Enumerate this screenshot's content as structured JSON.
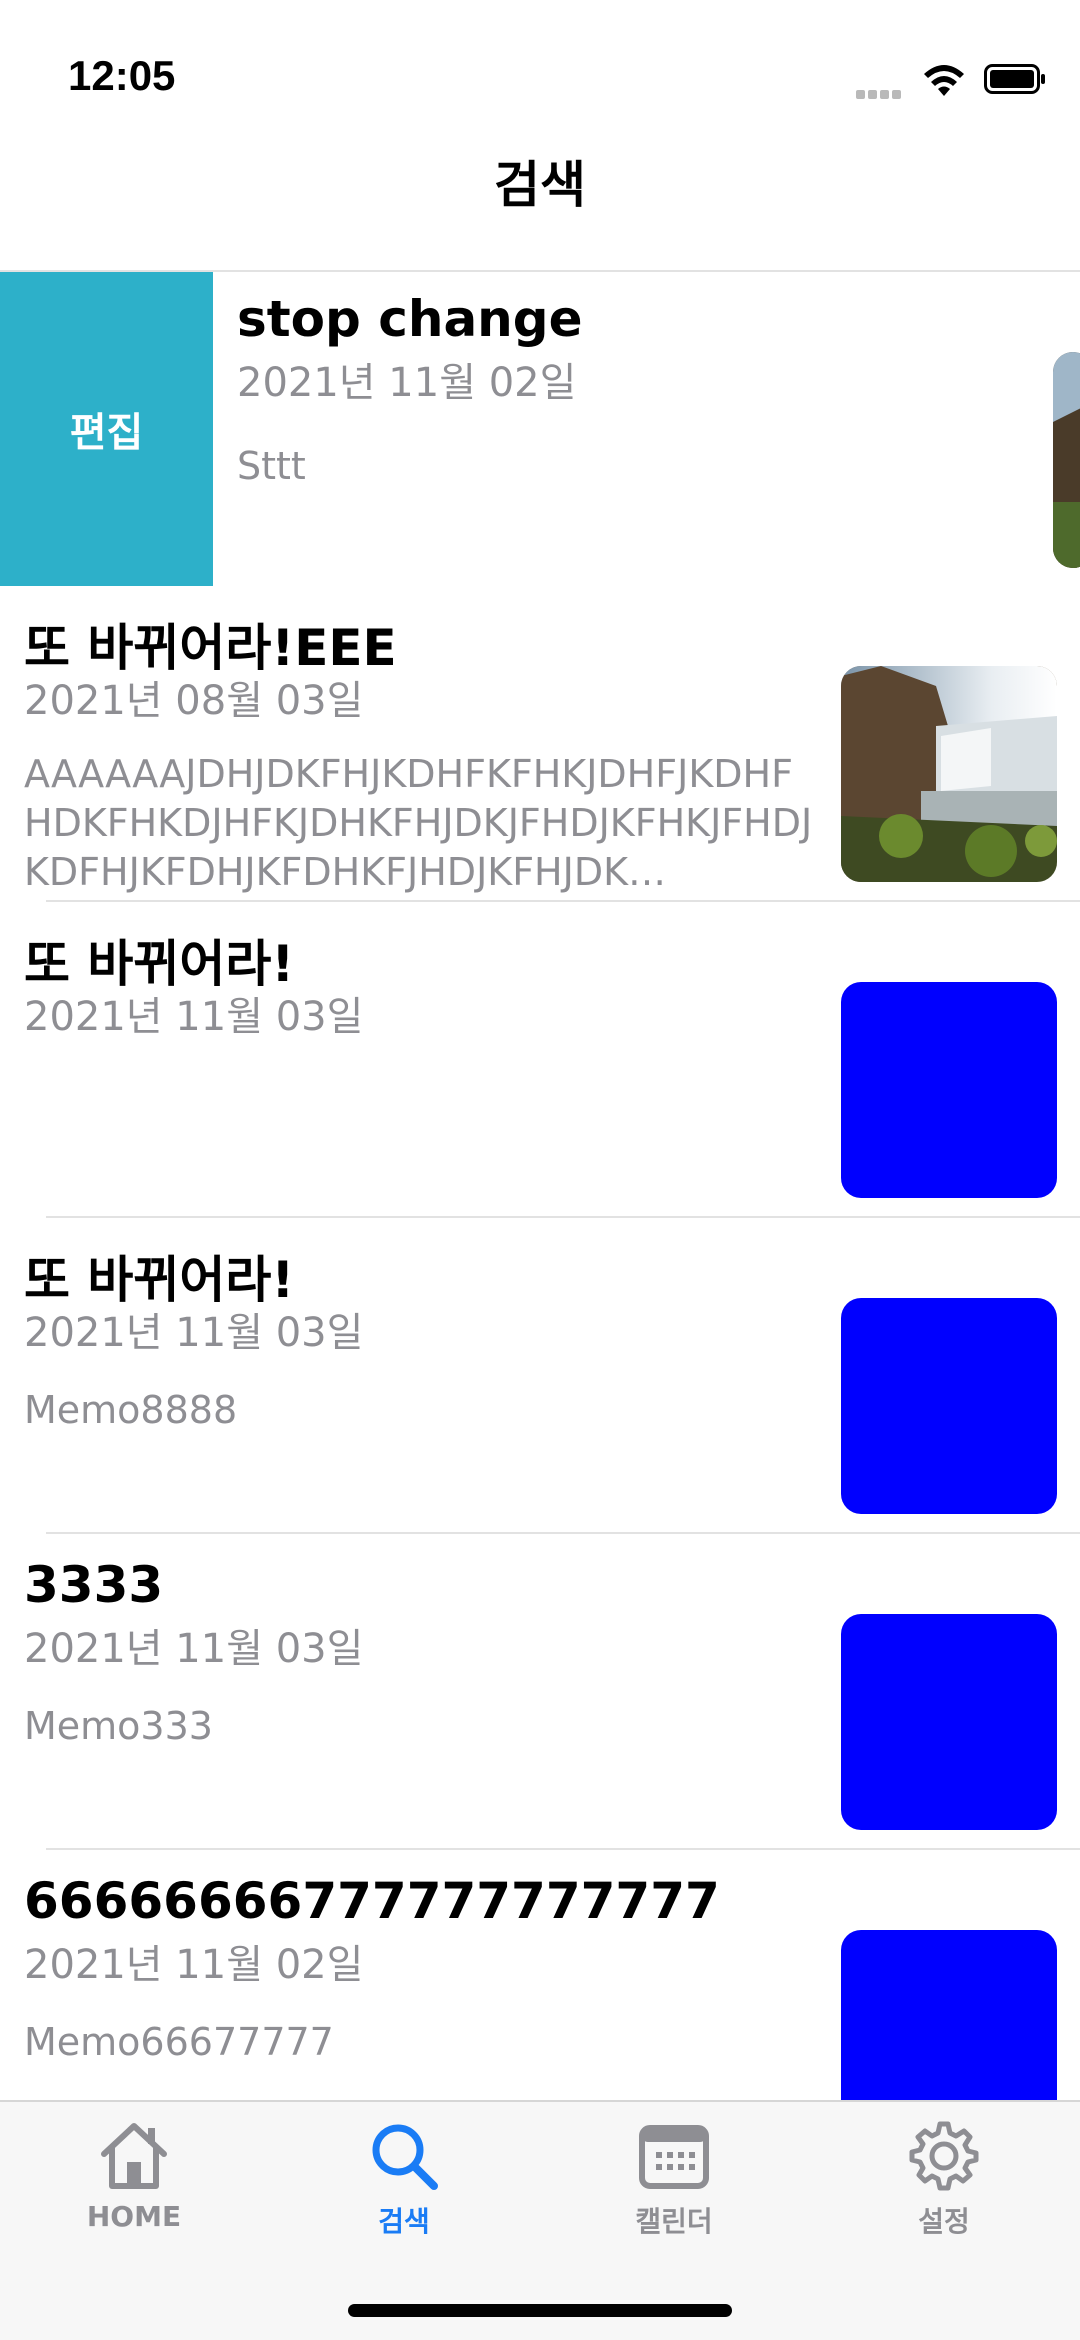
{
  "status": {
    "time": "12:05"
  },
  "nav": {
    "title": "검색"
  },
  "swipe_action": {
    "label": "편집",
    "color": "#2db0c9"
  },
  "rows": [
    {
      "title": "stop change",
      "date": "2021년 11월 02일",
      "memo": "Sttt",
      "thumb": "landscape-image"
    },
    {
      "title": "또 바뀌어라!EEE",
      "date": "2021년 08월 03일",
      "memo": "AAAAAAJDHJDKFHJKDHFKFHKJDHFJKDHFHDKFHKDJHFKJDHKFHJDKJFHDJKFHKJFHDJKDFHJKFDHJKFDHKFJHDJKFHJDK…",
      "thumb": "landscape-image"
    },
    {
      "title": "또 바뀌어라!",
      "date": "2021년 11월 03일",
      "memo": "",
      "thumb": "blue"
    },
    {
      "title": "또 바뀌어라!",
      "date": "2021년 11월 03일",
      "memo": "Memo8888",
      "thumb": "blue"
    },
    {
      "title": "3333",
      "date": "2021년 11월 03일",
      "memo": "Memo333",
      "thumb": "blue"
    },
    {
      "title": "66666666777777777777",
      "date": "2021년 11월 02일",
      "memo": "Memo66677777",
      "thumb": "blue"
    }
  ],
  "tabs": [
    {
      "label": "HOME",
      "icon": "home-icon",
      "active": false
    },
    {
      "label": "검색",
      "icon": "search-icon",
      "active": true
    },
    {
      "label": "캘린더",
      "icon": "calendar-icon",
      "active": false
    },
    {
      "label": "설정",
      "icon": "gear-icon",
      "active": false
    }
  ],
  "colors": {
    "accent": "#1a7cf5",
    "thumb_blue": "#0000ff",
    "secondary_text": "#8e8e93"
  }
}
